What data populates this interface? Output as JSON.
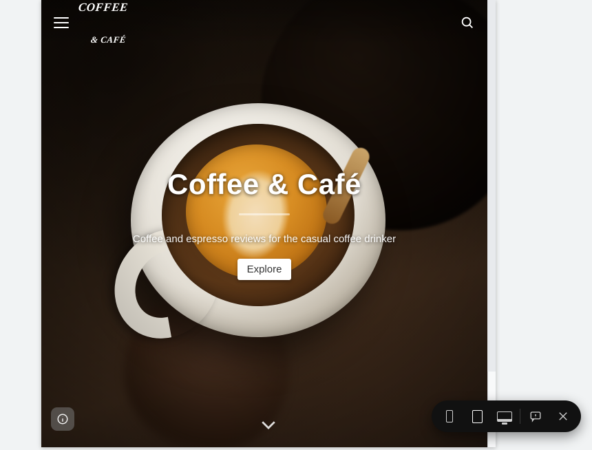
{
  "logo": {
    "line1": "COFFEE",
    "line2": "& CAFÉ"
  },
  "hero": {
    "title": "Coffee & Café",
    "tagline": "Coffee and espresso reviews for the casual coffee drinker",
    "cta": "Explore"
  },
  "toolbar": {
    "devices": [
      "phone",
      "tablet",
      "desktop"
    ],
    "active_device": "tablet"
  }
}
